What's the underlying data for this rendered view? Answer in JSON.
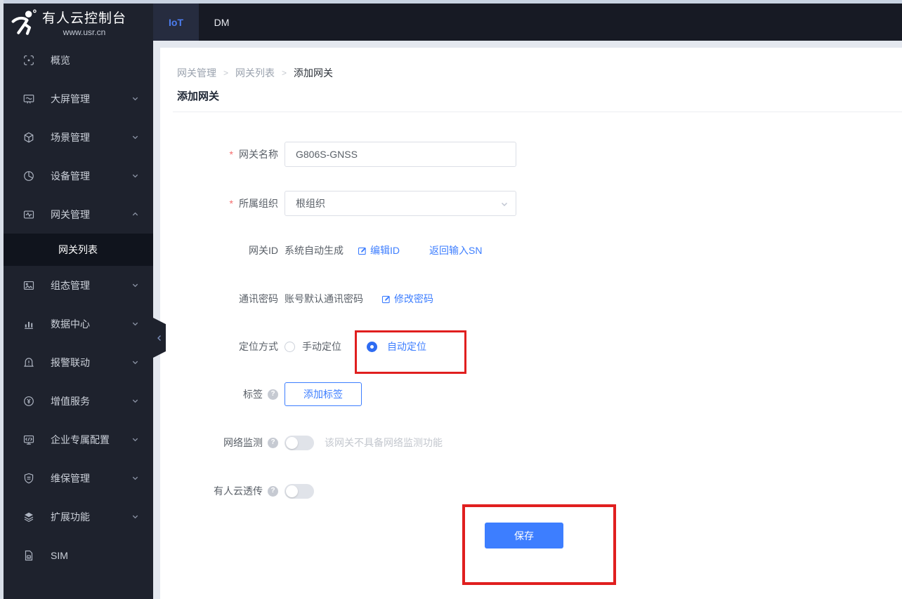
{
  "brand": {
    "title": "有人云控制台",
    "subtitle": "www.usr.cn"
  },
  "topbar": {
    "tabs": [
      {
        "label": "IoT"
      },
      {
        "label": "DM"
      }
    ]
  },
  "sidebar": {
    "items": [
      {
        "label": "概览"
      },
      {
        "label": "大屏管理"
      },
      {
        "label": "场景管理"
      },
      {
        "label": "设备管理"
      },
      {
        "label": "网关管理"
      },
      {
        "label": "组态管理"
      },
      {
        "label": "数据中心"
      },
      {
        "label": "报警联动"
      },
      {
        "label": "增值服务"
      },
      {
        "label": "企业专属配置"
      },
      {
        "label": "维保管理"
      },
      {
        "label": "扩展功能"
      },
      {
        "label": "SIM"
      }
    ],
    "submenu": {
      "label": "网关列表"
    }
  },
  "breadcrumb": {
    "separator": ">",
    "items": [
      {
        "label": "网关管理"
      },
      {
        "label": "网关列表"
      },
      {
        "label": "添加网关"
      }
    ]
  },
  "page": {
    "title": "添加网关"
  },
  "form": {
    "gateway_name": {
      "required_mark": "*",
      "label": "网关名称",
      "value": "G806S-GNSS"
    },
    "organization": {
      "required_mark": "*",
      "label": "所属组织",
      "value": "根组织"
    },
    "gateway_id": {
      "label": "网关ID",
      "value": "系统自动生成",
      "edit_link": "编辑ID",
      "sn_link": "返回输入SN"
    },
    "comm_password": {
      "label": "通讯密码",
      "value": "账号默认通讯密码",
      "edit_link": "修改密码"
    },
    "positioning": {
      "label": "定位方式",
      "manual_option": "手动定位",
      "auto_option": "自动定位",
      "selected": "自动定位"
    },
    "tags": {
      "label": "标签",
      "add_button": "添加标签"
    },
    "network_monitor": {
      "label": "网络监测",
      "state": "off",
      "hint": "该网关不具备网络监测功能"
    },
    "cloud_passthrough": {
      "label": "有人云透传",
      "state": "off"
    },
    "save_button": {
      "label": "保存"
    }
  },
  "colors": {
    "accent": "#3D7EFF",
    "annotation_red": "#E01F1F",
    "topbar_bg": "#171A24",
    "sidebar_bg": "#1E222D",
    "required_red": "#F56C6C"
  }
}
